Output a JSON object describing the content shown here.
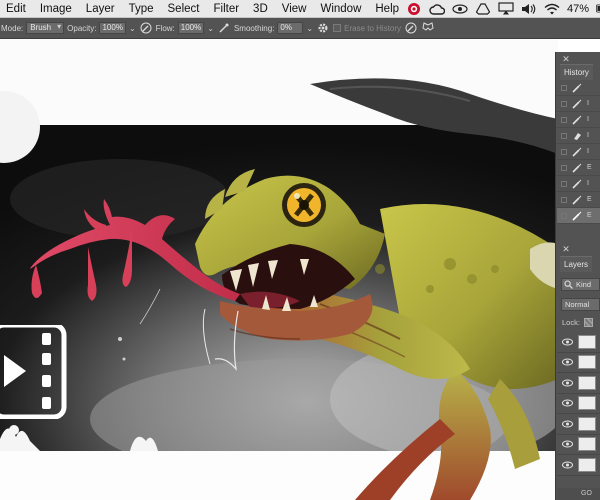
{
  "menubar": {
    "items": [
      "Edit",
      "Image",
      "Layer",
      "Type",
      "Select",
      "Filter",
      "3D",
      "View",
      "Window",
      "Help"
    ],
    "battery": "47%"
  },
  "options": {
    "mode_label": "Mode:",
    "mode_value": "Brush",
    "opacity_label": "Opacity:",
    "opacity_value": "100%",
    "flow_label": "Flow:",
    "flow_value": "100%",
    "smoothing_label": "Smoothing:",
    "smoothing_value": "0%",
    "erase_to_history": "Erase to History"
  },
  "history_panel": {
    "title": "History",
    "rows": [
      {
        "icon": "brush-icon",
        "label": ""
      },
      {
        "icon": "brush-icon",
        "label": "I"
      },
      {
        "icon": "brush-icon",
        "label": "I"
      },
      {
        "icon": "eraser-icon",
        "label": "I"
      },
      {
        "icon": "brush-icon",
        "label": "I"
      },
      {
        "icon": "brush-icon",
        "label": "E"
      },
      {
        "icon": "brush-icon",
        "label": "I"
      },
      {
        "icon": "brush-icon",
        "label": "E"
      },
      {
        "icon": "brush-icon",
        "label": "E"
      }
    ]
  },
  "layers_panel": {
    "title": "Layers",
    "kind_label": "Kind",
    "blend_mode": "Normal",
    "lock_label": "Lock:",
    "footer": "GO"
  },
  "colors": {
    "menubar_bg": "#e9e9e9",
    "optionsbar_bg": "#535353",
    "panel_bg": "#535353",
    "tongue": "#d8405a",
    "creature_body": "#a4a83a"
  }
}
